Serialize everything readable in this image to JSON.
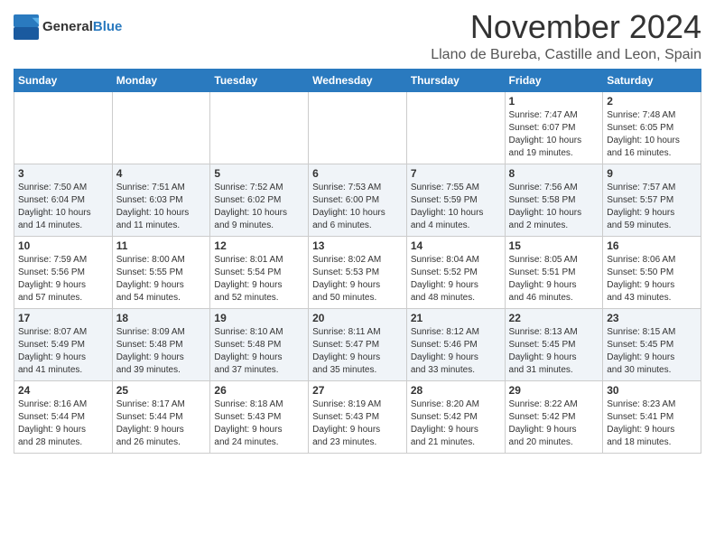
{
  "header": {
    "logo_general": "General",
    "logo_blue": "Blue",
    "month_title": "November 2024",
    "location": "Llano de Bureba, Castille and Leon, Spain"
  },
  "columns": [
    "Sunday",
    "Monday",
    "Tuesday",
    "Wednesday",
    "Thursday",
    "Friday",
    "Saturday"
  ],
  "weeks": [
    [
      {
        "day": "",
        "info": ""
      },
      {
        "day": "",
        "info": ""
      },
      {
        "day": "",
        "info": ""
      },
      {
        "day": "",
        "info": ""
      },
      {
        "day": "",
        "info": ""
      },
      {
        "day": "1",
        "info": "Sunrise: 7:47 AM\nSunset: 6:07 PM\nDaylight: 10 hours\nand 19 minutes."
      },
      {
        "day": "2",
        "info": "Sunrise: 7:48 AM\nSunset: 6:05 PM\nDaylight: 10 hours\nand 16 minutes."
      }
    ],
    [
      {
        "day": "3",
        "info": "Sunrise: 7:50 AM\nSunset: 6:04 PM\nDaylight: 10 hours\nand 14 minutes."
      },
      {
        "day": "4",
        "info": "Sunrise: 7:51 AM\nSunset: 6:03 PM\nDaylight: 10 hours\nand 11 minutes."
      },
      {
        "day": "5",
        "info": "Sunrise: 7:52 AM\nSunset: 6:02 PM\nDaylight: 10 hours\nand 9 minutes."
      },
      {
        "day": "6",
        "info": "Sunrise: 7:53 AM\nSunset: 6:00 PM\nDaylight: 10 hours\nand 6 minutes."
      },
      {
        "day": "7",
        "info": "Sunrise: 7:55 AM\nSunset: 5:59 PM\nDaylight: 10 hours\nand 4 minutes."
      },
      {
        "day": "8",
        "info": "Sunrise: 7:56 AM\nSunset: 5:58 PM\nDaylight: 10 hours\nand 2 minutes."
      },
      {
        "day": "9",
        "info": "Sunrise: 7:57 AM\nSunset: 5:57 PM\nDaylight: 9 hours\nand 59 minutes."
      }
    ],
    [
      {
        "day": "10",
        "info": "Sunrise: 7:59 AM\nSunset: 5:56 PM\nDaylight: 9 hours\nand 57 minutes."
      },
      {
        "day": "11",
        "info": "Sunrise: 8:00 AM\nSunset: 5:55 PM\nDaylight: 9 hours\nand 54 minutes."
      },
      {
        "day": "12",
        "info": "Sunrise: 8:01 AM\nSunset: 5:54 PM\nDaylight: 9 hours\nand 52 minutes."
      },
      {
        "day": "13",
        "info": "Sunrise: 8:02 AM\nSunset: 5:53 PM\nDaylight: 9 hours\nand 50 minutes."
      },
      {
        "day": "14",
        "info": "Sunrise: 8:04 AM\nSunset: 5:52 PM\nDaylight: 9 hours\nand 48 minutes."
      },
      {
        "day": "15",
        "info": "Sunrise: 8:05 AM\nSunset: 5:51 PM\nDaylight: 9 hours\nand 46 minutes."
      },
      {
        "day": "16",
        "info": "Sunrise: 8:06 AM\nSunset: 5:50 PM\nDaylight: 9 hours\nand 43 minutes."
      }
    ],
    [
      {
        "day": "17",
        "info": "Sunrise: 8:07 AM\nSunset: 5:49 PM\nDaylight: 9 hours\nand 41 minutes."
      },
      {
        "day": "18",
        "info": "Sunrise: 8:09 AM\nSunset: 5:48 PM\nDaylight: 9 hours\nand 39 minutes."
      },
      {
        "day": "19",
        "info": "Sunrise: 8:10 AM\nSunset: 5:48 PM\nDaylight: 9 hours\nand 37 minutes."
      },
      {
        "day": "20",
        "info": "Sunrise: 8:11 AM\nSunset: 5:47 PM\nDaylight: 9 hours\nand 35 minutes."
      },
      {
        "day": "21",
        "info": "Sunrise: 8:12 AM\nSunset: 5:46 PM\nDaylight: 9 hours\nand 33 minutes."
      },
      {
        "day": "22",
        "info": "Sunrise: 8:13 AM\nSunset: 5:45 PM\nDaylight: 9 hours\nand 31 minutes."
      },
      {
        "day": "23",
        "info": "Sunrise: 8:15 AM\nSunset: 5:45 PM\nDaylight: 9 hours\nand 30 minutes."
      }
    ],
    [
      {
        "day": "24",
        "info": "Sunrise: 8:16 AM\nSunset: 5:44 PM\nDaylight: 9 hours\nand 28 minutes."
      },
      {
        "day": "25",
        "info": "Sunrise: 8:17 AM\nSunset: 5:44 PM\nDaylight: 9 hours\nand 26 minutes."
      },
      {
        "day": "26",
        "info": "Sunrise: 8:18 AM\nSunset: 5:43 PM\nDaylight: 9 hours\nand 24 minutes."
      },
      {
        "day": "27",
        "info": "Sunrise: 8:19 AM\nSunset: 5:43 PM\nDaylight: 9 hours\nand 23 minutes."
      },
      {
        "day": "28",
        "info": "Sunrise: 8:20 AM\nSunset: 5:42 PM\nDaylight: 9 hours\nand 21 minutes."
      },
      {
        "day": "29",
        "info": "Sunrise: 8:22 AM\nSunset: 5:42 PM\nDaylight: 9 hours\nand 20 minutes."
      },
      {
        "day": "30",
        "info": "Sunrise: 8:23 AM\nSunset: 5:41 PM\nDaylight: 9 hours\nand 18 minutes."
      }
    ]
  ]
}
